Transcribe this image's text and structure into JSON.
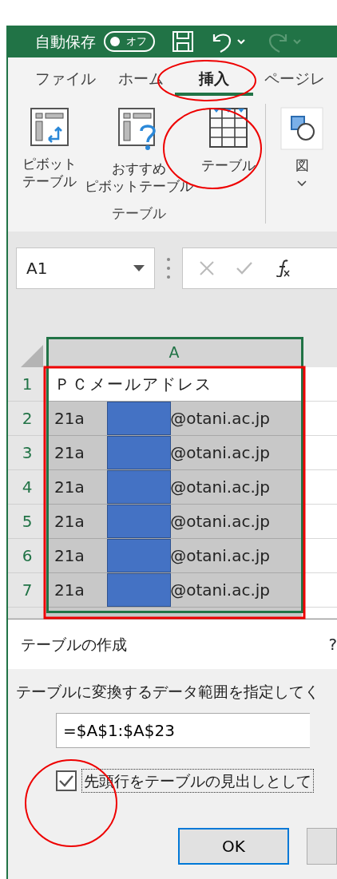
{
  "title_bar": {
    "autosave_label": "自動保存",
    "autosave_toggle": {
      "label": "オフ",
      "on": false
    },
    "redo_disabled": true
  },
  "ribbon": {
    "tabs": [
      {
        "label": "ファイル",
        "selected": false
      },
      {
        "label": "ホーム",
        "selected": false
      },
      {
        "label": "挿入",
        "selected": true
      },
      {
        "label": "ページレ",
        "selected": false
      }
    ],
    "buttons": [
      {
        "kind": "pivot",
        "lines": [
          "ピボット",
          "テーブル"
        ]
      },
      {
        "kind": "recommended",
        "lines": [
          "おすすめ",
          "ピボットテーブル"
        ]
      },
      {
        "kind": "table",
        "lines": [
          "テーブル"
        ]
      }
    ],
    "group_label": "テーブル",
    "shapes_button": {
      "label": "図"
    }
  },
  "formula_bar": {
    "name_box": "A1"
  },
  "sheet": {
    "columns": [
      "A"
    ],
    "rows": [
      {
        "number": "1",
        "kind": "text",
        "cell": "ＰＣメールアドレス",
        "active": true
      },
      {
        "number": "2",
        "kind": "redacted",
        "prefix": "21a",
        "suffix": "@otani.ac.jp",
        "active": false
      },
      {
        "number": "3",
        "kind": "redacted",
        "prefix": "21a",
        "suffix": "@otani.ac.jp",
        "active": false
      },
      {
        "number": "4",
        "kind": "redacted",
        "prefix": "21a",
        "suffix": "@otani.ac.jp",
        "active": false
      },
      {
        "number": "5",
        "kind": "redacted",
        "prefix": "21a",
        "suffix": "@otani.ac.jp",
        "active": false
      },
      {
        "number": "6",
        "kind": "redacted",
        "prefix": "21a",
        "suffix": "@otani.ac.jp",
        "active": false
      },
      {
        "number": "7",
        "kind": "redacted",
        "prefix": "21a",
        "suffix": "@otani.ac.jp",
        "active": false
      }
    ]
  },
  "dialog": {
    "title": "テーブルの作成",
    "help": "?",
    "prompt": "テーブルに変換するデータ範囲を指定してく",
    "range": "=$A$1:$A$23",
    "header_checkbox": {
      "label": "先頭行をテーブルの見出しとして",
      "checked": true
    },
    "buttons": [
      {
        "label": "OK",
        "default": true
      },
      {
        "default": false
      }
    ]
  }
}
